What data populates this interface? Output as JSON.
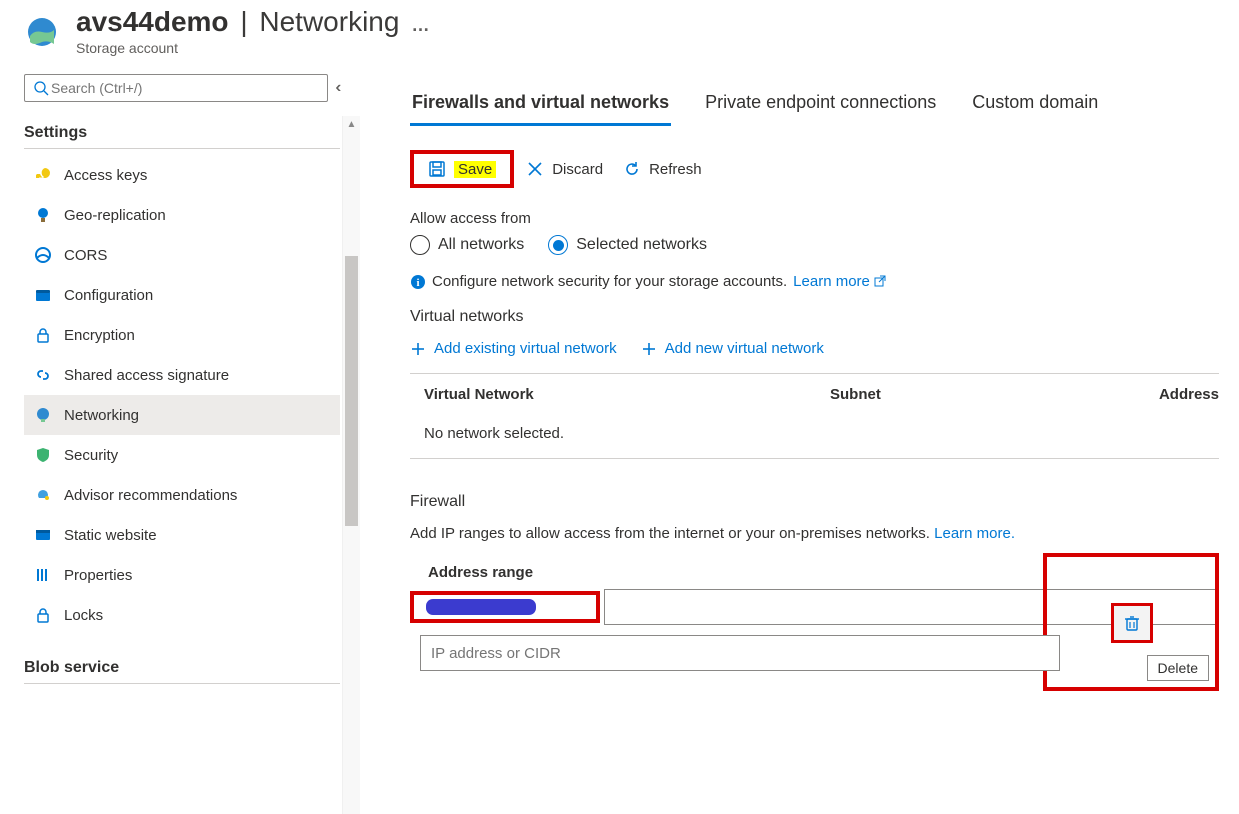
{
  "header": {
    "resource_name": "avs44demo",
    "page_name": "Networking",
    "subtitle": "Storage account"
  },
  "sidebar": {
    "search_placeholder": "Search (Ctrl+/)",
    "section_settings": "Settings",
    "section_blob": "Blob service",
    "items": {
      "access_keys": "Access keys",
      "geo_replication": "Geo-replication",
      "cors": "CORS",
      "configuration": "Configuration",
      "encryption": "Encryption",
      "sas": "Shared access signature",
      "networking": "Networking",
      "security": "Security",
      "advisor": "Advisor recommendations",
      "static_website": "Static website",
      "properties": "Properties",
      "locks": "Locks"
    }
  },
  "tabs": {
    "firewall": "Firewalls and virtual networks",
    "pec": "Private endpoint connections",
    "custom": "Custom domain"
  },
  "toolbar": {
    "save": "Save",
    "discard": "Discard",
    "refresh": "Refresh"
  },
  "access": {
    "label": "Allow access from",
    "all": "All networks",
    "selected": "Selected networks"
  },
  "info": {
    "text": "Configure network security for your storage accounts.",
    "link": "Learn more"
  },
  "vnet": {
    "title": "Virtual networks",
    "add_existing": "Add existing virtual network",
    "add_new": "Add new virtual network",
    "col_network": "Virtual Network",
    "col_subnet": "Subnet",
    "col_address": "Address",
    "empty": "No network selected."
  },
  "firewall": {
    "title": "Firewall",
    "desc": "Add IP ranges to allow access from the internet or your on-premises networks.",
    "link": "Learn more.",
    "address_range": "Address range",
    "placeholder": "IP address or CIDR",
    "delete": "Delete"
  }
}
